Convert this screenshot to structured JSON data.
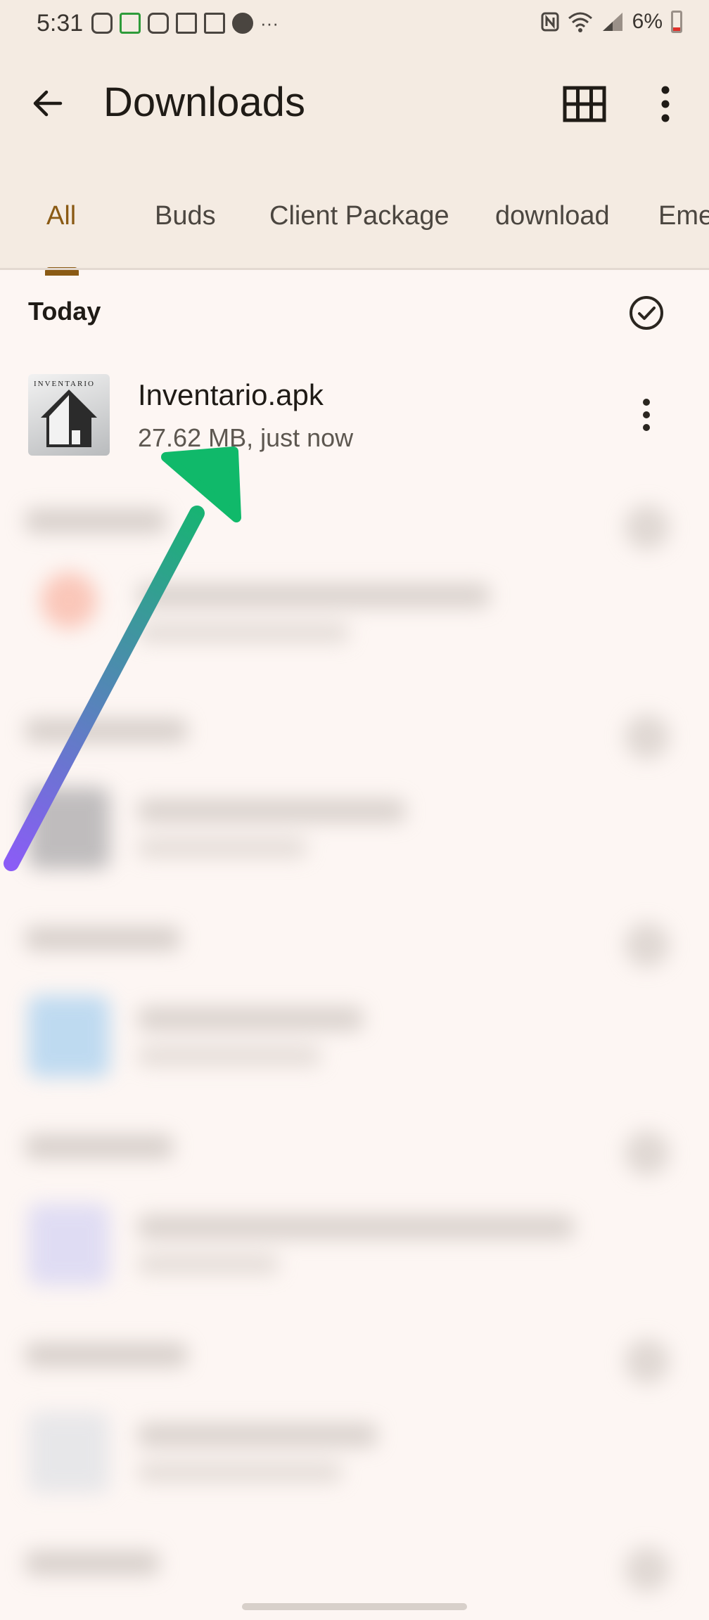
{
  "status_bar": {
    "time": "5:31",
    "battery": "6%",
    "notification_icons": [
      "instagram-icon",
      "td-icon",
      "instagram-icon",
      "gmail-icon",
      "twitch-icon",
      "spotify-icon",
      "more-icon"
    ],
    "system_icons": [
      "nfc-icon",
      "wifi-icon",
      "signal-icon",
      "battery-icon"
    ]
  },
  "app_bar": {
    "title": "Downloads"
  },
  "tabs": [
    {
      "label": "All",
      "active": true
    },
    {
      "label": "Buds"
    },
    {
      "label": "Client Package"
    },
    {
      "label": "download"
    },
    {
      "label": "Eme"
    }
  ],
  "section": {
    "title": "Today"
  },
  "file": {
    "name": "Inventario.apk",
    "meta": "27.62 MB, just now",
    "thumbnail_text": "INVENTARIO"
  },
  "colors": {
    "accent": "#8a5a14",
    "header_bg": "#f4ebe2",
    "content_bg": "#fdf6f3",
    "arrow_start": "#8b5cf6",
    "arrow_end": "#10b96a"
  }
}
